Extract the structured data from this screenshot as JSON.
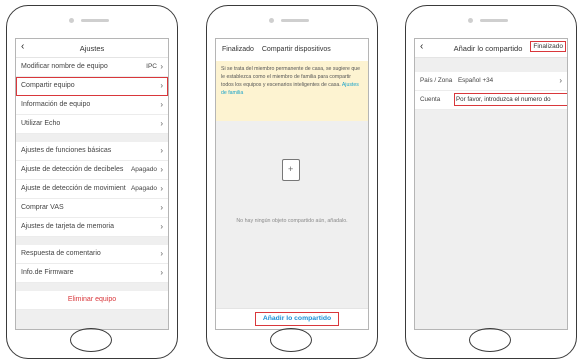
{
  "screens": {
    "settings": {
      "title": "Ajustes",
      "back_icon": "chevron-left-icon",
      "groups": [
        [
          {
            "label": "Modificar nombre de equipo",
            "value": "IPC"
          },
          {
            "label": "Compartir equipo",
            "value": "",
            "highlighted": true
          },
          {
            "label": "Información de equipo",
            "value": ""
          },
          {
            "label": "Utilizar Echo",
            "value": ""
          }
        ],
        [
          {
            "label": "Ajustes de funciones básicas",
            "value": ""
          },
          {
            "label": "Ajuste de detección de decibeles",
            "value": "Apagado"
          },
          {
            "label": "Ajuste de detección de movimient",
            "value": "Apagado"
          },
          {
            "label": "Comprar VAS",
            "value": ""
          },
          {
            "label": "Ajustes de tarjeta de memoria",
            "value": ""
          }
        ],
        [
          {
            "label": "Respuesta de comentario",
            "value": ""
          },
          {
            "label": "Info.de Firmware",
            "value": ""
          }
        ]
      ],
      "delete_label": "Eliminar equipo"
    },
    "share": {
      "done_label": "Finalizado",
      "title": "Compartir dispositivos",
      "notice": "Si se trata del miembro permanente de casa, se sugiere que le establezca como el miembro de familia para compartir todos los equipos y escenarios inteligentes de casa.",
      "notice_link": "Ajustes de familia",
      "empty_icon": "empty-document-icon",
      "empty_text": "No hay ningún objeto compartido aún, añadalo.",
      "add_label": "Añadir lo compartido"
    },
    "add_share": {
      "title": "Añadir lo compartido",
      "done_label": "Finalizado",
      "country_label": "País / Zona",
      "country_value": "Español +34",
      "account_label": "Cuenta",
      "account_placeholder": "Por favor, introduzca el numero do"
    }
  },
  "colors": {
    "highlight": "#d9373b",
    "link": "#1aa3c9",
    "accent": "#1a8fd6",
    "notice_bg": "#fdf3d1"
  }
}
